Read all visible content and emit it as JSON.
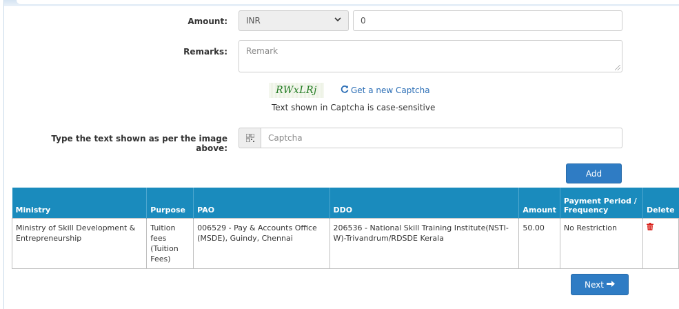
{
  "form": {
    "amount_label": "Amount:",
    "currency_value": "INR",
    "amount_value": "0",
    "remarks_label": "Remarks:",
    "remarks_placeholder": "Remark",
    "captcha_text": "RWxLRj",
    "captcha_refresh_label": "Get a new Captcha",
    "captcha_note": "Text shown in Captcha is case-sensitive",
    "captcha_input_label": "Type the text shown as per the image above:",
    "captcha_placeholder": "Captcha",
    "add_button": "Add",
    "next_button": "Next"
  },
  "table": {
    "headers": {
      "ministry": "Ministry",
      "purpose": "Purpose",
      "pao": "PAO",
      "ddo": "DDO",
      "amount": "Amount",
      "payment_period": "Payment Period / Frequency",
      "delete": "Delete"
    },
    "rows": [
      {
        "ministry": "Ministry of Skill Development & Entrepreneurship",
        "purpose": "Tuition fees (Tuition Fees)",
        "pao": "006529 - Pay & Accounts Office (MSDE), Guindy, Chennai",
        "ddo": "206536 - National Skill Training Institute(NSTI-W)-Trivandrum/RDSDE Kerala",
        "amount": "50.00",
        "payment_period": "No Restriction"
      }
    ]
  },
  "icons": {
    "refresh": "refresh-icon",
    "captcha_addon": "barcode-icon",
    "delete": "trash-icon",
    "next_arrow": "arrow-right-icon",
    "select_chevron": "chevron-down-icon"
  },
  "colors": {
    "table_header": "#1a8bbd",
    "button": "#2f7cc4",
    "link": "#2a6db5",
    "delete_icon": "#d9231c",
    "captcha_text": "#1f7a1f"
  }
}
